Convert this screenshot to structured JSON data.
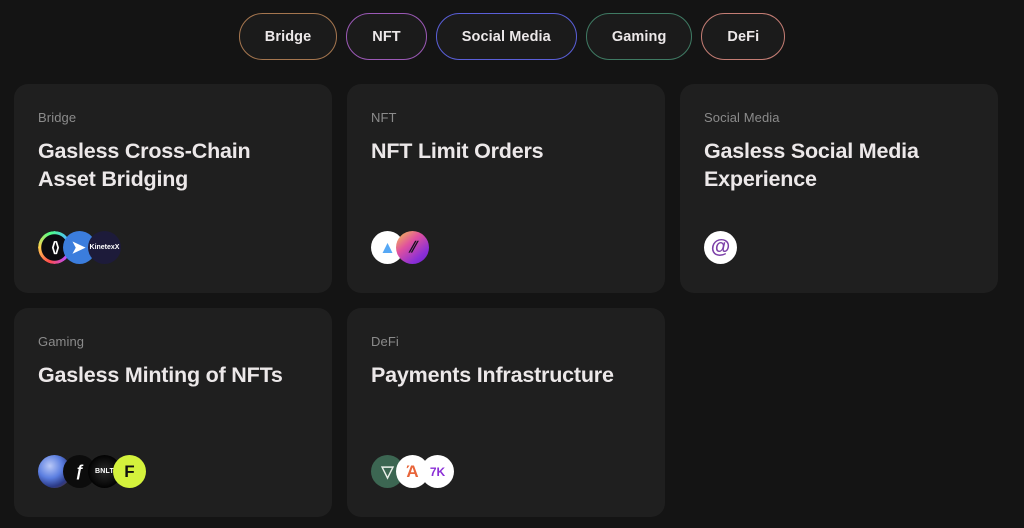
{
  "theme": {
    "page_bg": "#141414",
    "card_bg": "#1f1f1f",
    "title_color": "#ece8e9",
    "category_color": "#8b8b8b"
  },
  "filters": [
    {
      "label": "Bridge",
      "border_color": "#a5764f"
    },
    {
      "label": "NFT",
      "border_color": "#9b59b6"
    },
    {
      "label": "Social Media",
      "border_color": "#5a5fd8"
    },
    {
      "label": "Gaming",
      "border_color": "#3f7a63"
    },
    {
      "label": "DeFi",
      "border_color": "#c47d74"
    }
  ],
  "cards": [
    {
      "category": "Bridge",
      "title": "Gasless Cross-Chain Asset Bridging",
      "logos": [
        {
          "name": "socket-logo",
          "skin": "lg-socket",
          "glyph": "⟨⟩"
        },
        {
          "name": "bridge-logo",
          "skin": "lg-blue",
          "glyph": "➤"
        },
        {
          "name": "kinetex-logo",
          "skin": "lg-kx",
          "glyph": "KinetexX"
        }
      ]
    },
    {
      "category": "NFT",
      "title": "NFT Limit Orders",
      "logos": [
        {
          "name": "blur-logo",
          "skin": "lg-white-arrow",
          "glyph": "▲"
        },
        {
          "name": "tensor-logo",
          "skin": "lg-grad-purple",
          "glyph": "⫽"
        }
      ]
    },
    {
      "category": "Social Media",
      "title": "Gasless Social Media Experience",
      "logos": [
        {
          "name": "lens-logo",
          "skin": "lg-lens",
          "glyph": "@"
        }
      ]
    },
    {
      "category": "Gaming",
      "title": "Gasless Minting of NFTs",
      "logos": [
        {
          "name": "orb-logo",
          "skin": "lg-sphere",
          "glyph": ""
        },
        {
          "name": "flame-logo",
          "skin": "lg-black-f",
          "glyph": "ƒ"
        },
        {
          "name": "bnlt-logo",
          "skin": "lg-bnlt",
          "glyph": "BNLT"
        },
        {
          "name": "fuel-logo",
          "skin": "lg-lime",
          "glyph": "F"
        }
      ]
    },
    {
      "category": "DeFi",
      "title": "Payments Infrastructure",
      "logos": [
        {
          "name": "owl-logo",
          "skin": "lg-owl",
          "glyph": "▽"
        },
        {
          "name": "bundlr-logo",
          "skin": "lg-orange",
          "glyph": "Ά"
        },
        {
          "name": "sevenk-logo",
          "skin": "lg-7k",
          "glyph": "7K"
        }
      ]
    }
  ]
}
